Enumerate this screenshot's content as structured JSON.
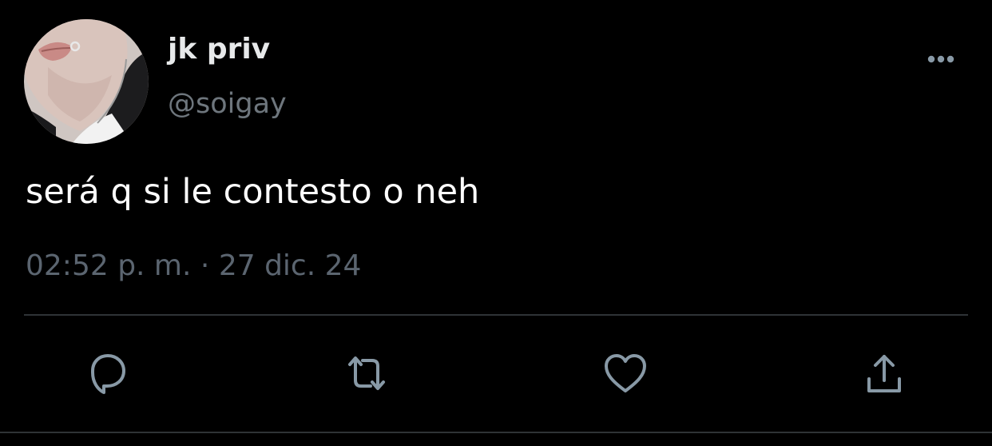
{
  "user": {
    "display_name": "jk priv",
    "handle": "@soigay"
  },
  "tweet": {
    "text": "será q si le contesto o neh",
    "time": "02:52 p. m.",
    "separator": "·",
    "date": "27 dic. 24"
  },
  "icons": {
    "more": "more-horizontal-icon",
    "reply": "reply-icon",
    "retweet": "retweet-icon",
    "like": "heart-icon",
    "share": "share-icon"
  },
  "colors": {
    "background": "#000000",
    "primary_text": "#e7e9ea",
    "secondary_text": "#6e767d",
    "icon": "#8899a6",
    "divider": "#2f3336"
  }
}
